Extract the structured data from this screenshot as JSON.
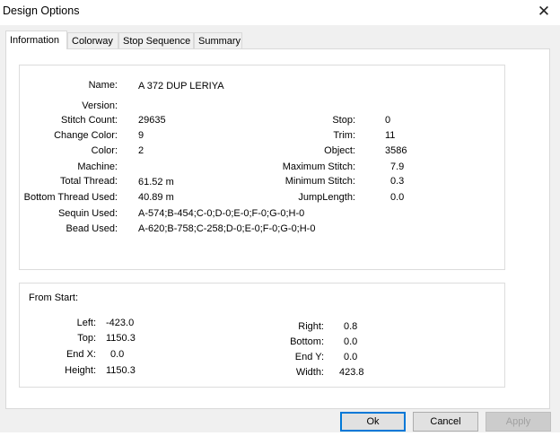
{
  "window": {
    "title": "Design Options"
  },
  "tabs": [
    "Information",
    "Colorway",
    "Stop Sequence",
    "Summary"
  ],
  "info": {
    "name_label": "Name:",
    "name_value": "A 372 DUP LERIYA",
    "version_label": "Version:",
    "version_value": "",
    "stitch_count_label": "Stitch Count:",
    "stitch_count_value": "29635",
    "change_color_label": "Change Color:",
    "change_color_value": "9",
    "color_label": "Color:",
    "color_value": "2",
    "machine_label": "Machine:",
    "machine_value": "",
    "total_thread_label": "Total Thread:",
    "total_thread_value": "61.52 m",
    "bottom_thread_label": "Bottom Thread Used:",
    "bottom_thread_value": "40.89 m",
    "sequin_label": "Sequin Used:",
    "sequin_value": "A-574;B-454;C-0;D-0;E-0;F-0;G-0;H-0",
    "bead_label": "Bead Used:",
    "bead_value": "A-620;B-758;C-258;D-0;E-0;F-0;G-0;H-0",
    "stop_label": "Stop:",
    "stop_value": "0",
    "trim_label": "Trim:",
    "trim_value": "11",
    "object_label": "Object:",
    "object_value": "3586",
    "max_stitch_label": "Maximum Stitch:",
    "max_stitch_value": "7.9",
    "min_stitch_label": "Minimum Stitch:",
    "min_stitch_value": "0.3",
    "jump_label": "JumpLength:",
    "jump_value": "0.0"
  },
  "from_start": {
    "heading": "From Start:",
    "left_label": "Left:",
    "left_value": "-423.0",
    "top_label": "Top:",
    "top_value": "1150.3",
    "endx_label": "End X:",
    "endx_value": "0.0",
    "height_label": "Height:",
    "height_value": "1150.3",
    "right_label": "Right:",
    "right_value": "0.8",
    "bottom_label": "Bottom:",
    "bottom_value": "0.0",
    "endy_label": "End Y:",
    "endy_value": "0.0",
    "width_label": "Width:",
    "width_value": "423.8"
  },
  "buttons": {
    "ok": "Ok",
    "cancel": "Cancel",
    "apply": "Apply"
  }
}
